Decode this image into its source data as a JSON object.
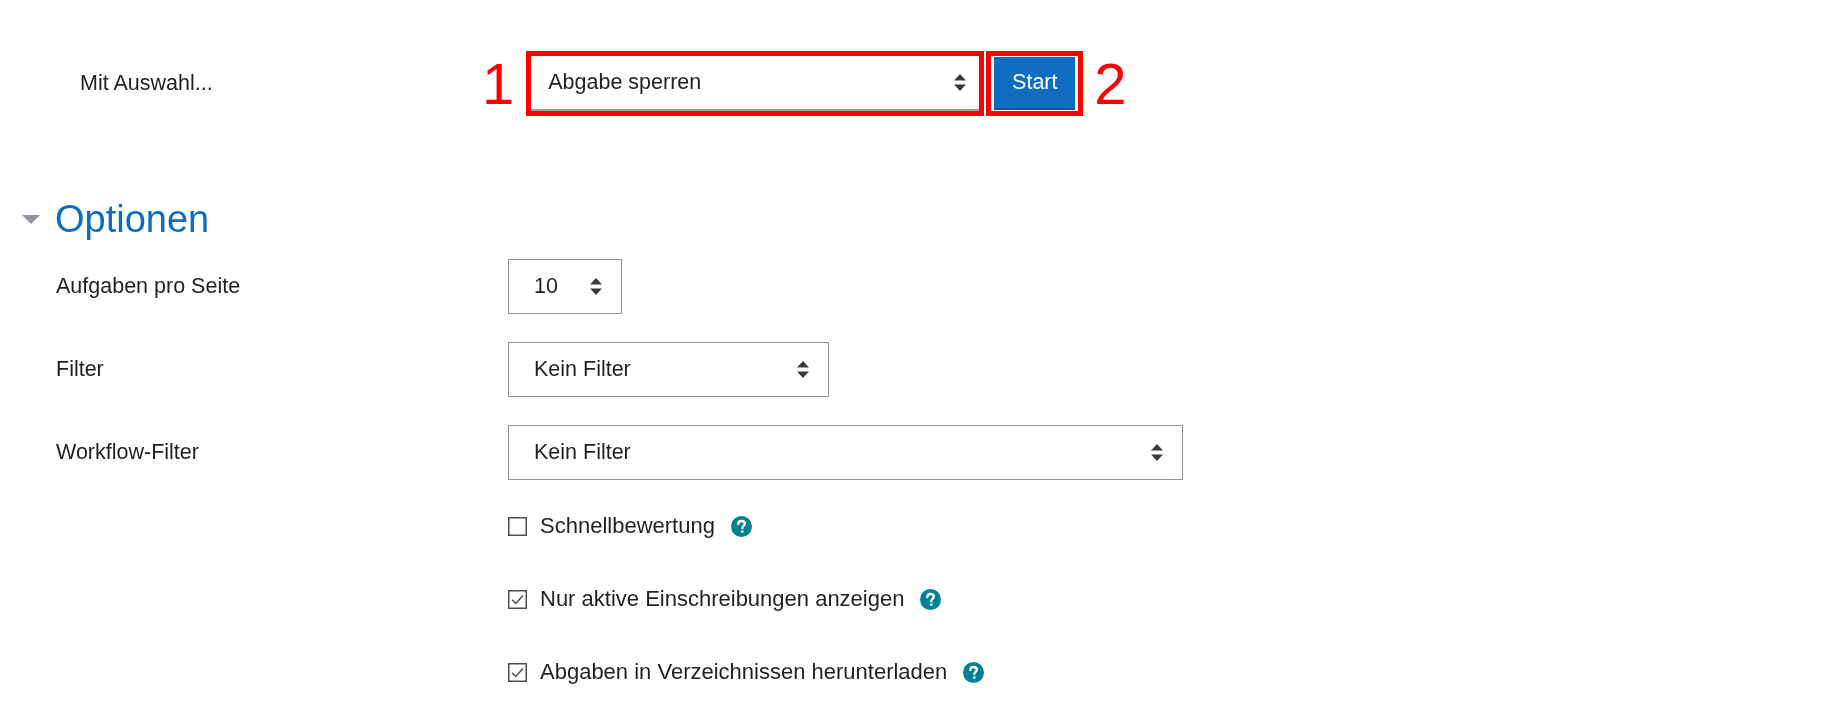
{
  "bulk_action": {
    "label": "Mit Auswahl...",
    "select": {
      "value": "Abgabe sperren",
      "annotation": "1"
    },
    "button": {
      "label": "Start",
      "annotation": "2"
    }
  },
  "options": {
    "title": "Optionen",
    "expanded": true,
    "fields": [
      {
        "label": "Aufgaben pro Seite",
        "value": "10"
      },
      {
        "label": "Filter",
        "value": "Kein Filter"
      },
      {
        "label": "Workflow-Filter",
        "value": "Kein Filter"
      }
    ],
    "checkboxes": [
      {
        "label": "Schnellbewertung",
        "checked": false,
        "help": true
      },
      {
        "label": "Nur aktive Einschreibungen anzeigen",
        "checked": true,
        "help": true
      },
      {
        "label": "Abgaben in Verzeichnissen herunterladen",
        "checked": true,
        "help": true
      }
    ]
  }
}
